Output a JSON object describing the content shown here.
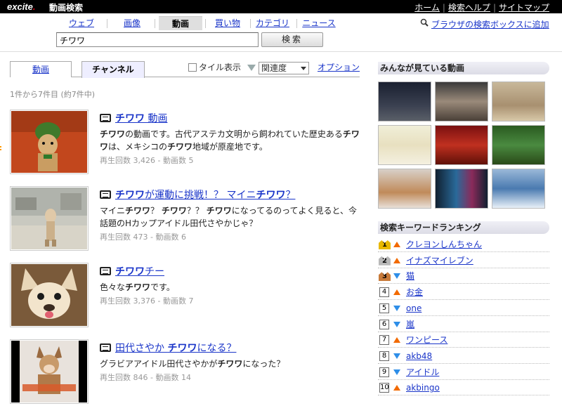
{
  "header": {
    "logo": "excite",
    "logo_dot": ".",
    "site_name": "動画検索",
    "links": [
      "ホーム",
      "検索ヘルプ",
      "サイトマップ"
    ]
  },
  "nav": {
    "items": [
      "ウェブ",
      "画像",
      "動画",
      "買い物",
      "カテゴリ",
      "ニュース"
    ],
    "active": "動画"
  },
  "search": {
    "query": "チワワ",
    "button": "検索",
    "browser_link": "ブラウザの検索ボックスに追加"
  },
  "tabs": [
    "動画",
    "チャンネル"
  ],
  "options": {
    "tile_view": "タイル表示",
    "sort": "関連度",
    "option_link": "オプション"
  },
  "result_count": "1件から7件目 (約7件中)",
  "results": [
    {
      "title_parts": [
        "チワワ",
        " 動画"
      ],
      "desc": "チワワの動画です。古代アステカ文明から飼われていた歴史あるチワワは、メキシコのチワワ地域が原産地です。",
      "meta": "再生回数 3,426 - 動画数 5"
    },
    {
      "title_parts": [
        "チワワ",
        "が運動に挑戦！？ マイニ",
        "チワワ",
        "？"
      ],
      "desc": "マイニチワワ？ チワワ？？ チワワになってるのってよく見ると、今話題のHカップアイドル田代さやかじゃ？",
      "meta": "再生回数 473 - 動画数 6"
    },
    {
      "title_parts": [
        "チワワ",
        "チー"
      ],
      "desc": "色々なチワワです。",
      "meta": "再生回数 3,376 - 動画数 7"
    },
    {
      "title_parts": [
        "田代さやか ",
        "チワワ",
        "になる？"
      ],
      "desc": "グラビアアイドル田代さやかがチワワになった？",
      "meta": "再生回数 846 - 動画数 14"
    }
  ],
  "sidebar": {
    "popular_title": "みんなが見ている動画",
    "ranking_title": "検索キーワードランキング",
    "ranking": [
      {
        "rank": "1",
        "word": "クレヨンしんちゃん",
        "trend": "up"
      },
      {
        "rank": "2",
        "word": "イナズマイレブン",
        "trend": "up"
      },
      {
        "rank": "3",
        "word": "猫",
        "trend": "down"
      },
      {
        "rank": "4",
        "word": "お金",
        "trend": "up"
      },
      {
        "rank": "5",
        "word": "one",
        "trend": "down"
      },
      {
        "rank": "6",
        "word": "嵐",
        "trend": "down"
      },
      {
        "rank": "7",
        "word": "ワンピース",
        "trend": "up"
      },
      {
        "rank": "8",
        "word": "akb48",
        "trend": "down"
      },
      {
        "rank": "9",
        "word": "アイドル",
        "trend": "down"
      },
      {
        "rank": "10",
        "word": "akbingo",
        "trend": "up"
      }
    ]
  },
  "colors": {
    "link": "#1a35c9",
    "trend_up": "#f26a00",
    "trend_down": "#2e8ee8",
    "topbar": "#000000"
  }
}
